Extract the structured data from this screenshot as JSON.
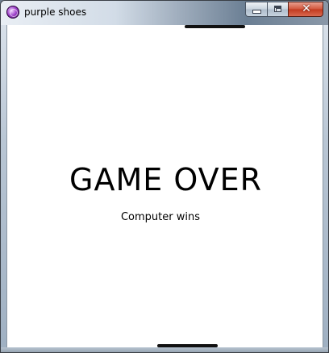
{
  "window": {
    "title": "purple shoes",
    "icon": "purple-shoes-app-icon",
    "caption_buttons": {
      "minimize_icon": "minimize-icon",
      "maximize_icon": "maximize-icon",
      "close_icon": "close-icon",
      "close_glyph": "✕"
    }
  },
  "game": {
    "headline": "GAME OVER",
    "result": "Computer wins"
  },
  "colors": {
    "client_background": "#ffffff",
    "text": "#000000",
    "close_button": "#c23a1f"
  }
}
